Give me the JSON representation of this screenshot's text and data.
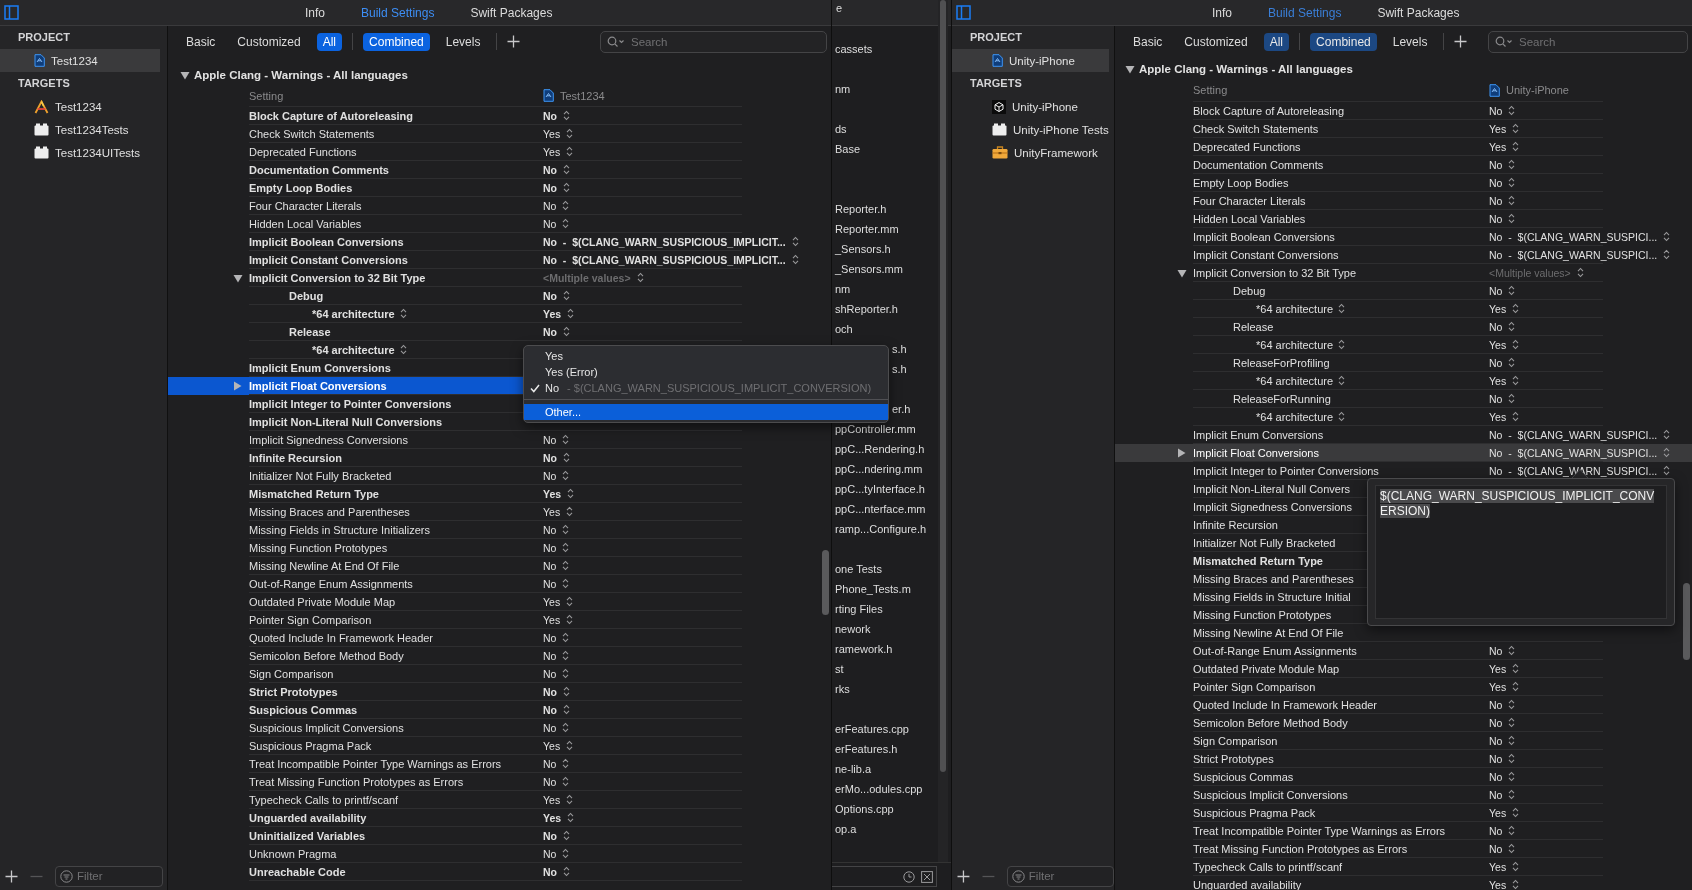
{
  "left_window": {
    "active": true,
    "tabs": [
      {
        "label": "Info",
        "selected": false
      },
      {
        "label": "Build Settings",
        "selected": true
      },
      {
        "label": "Swift Packages",
        "selected": false
      }
    ],
    "sidebar": {
      "sections": [
        {
          "title": "PROJECT",
          "items": [
            {
              "label": "Test1234",
              "kind": "project",
              "selected": true
            }
          ]
        },
        {
          "title": "TARGETS",
          "items": [
            {
              "label": "Test1234",
              "kind": "app",
              "selected": false
            },
            {
              "label": "Test1234Tests",
              "kind": "test_bundle",
              "selected": false
            },
            {
              "label": "Test1234UITests",
              "kind": "test_bundle",
              "selected": false
            }
          ]
        }
      ],
      "filter": {
        "placeholder": "Filter"
      }
    },
    "scope_buttons": [
      {
        "label": "Basic",
        "selected": false
      },
      {
        "label": "Customized",
        "selected": false
      },
      {
        "label": "All",
        "selected": true
      }
    ],
    "view_buttons": [
      {
        "label": "Combined",
        "selected": true
      },
      {
        "label": "Levels",
        "selected": false
      }
    ],
    "search": {
      "placeholder": "Search"
    },
    "section": {
      "title": "Apple Clang - Warnings - All languages",
      "expanded": true
    },
    "columns": {
      "setting": "Setting",
      "target": "Test1234"
    },
    "rows": [
      {
        "name": "Block Capture of Autoreleasing",
        "value": "No",
        "bold": true,
        "selected": false
      },
      {
        "name": "Check Switch Statements",
        "value": "Yes",
        "bold": false,
        "selected": false
      },
      {
        "name": "Deprecated Functions",
        "value": "Yes",
        "bold": false,
        "selected": false
      },
      {
        "name": "Documentation Comments",
        "value": "No",
        "bold": true,
        "selected": false
      },
      {
        "name": "Empty Loop Bodies",
        "value": "No",
        "bold": true,
        "selected": false
      },
      {
        "name": "Four Character Literals",
        "value": "No",
        "bold": false,
        "selected": false
      },
      {
        "name": "Hidden Local Variables",
        "value": "No",
        "bold": false,
        "selected": false
      },
      {
        "name": "Implicit Boolean Conversions",
        "value": "No  -  $(CLANG_WARN_SUSPICIOUS_IMPLICIT...",
        "bold": true,
        "selected": false
      },
      {
        "name": "Implicit Constant Conversions",
        "value": "No  -  $(CLANG_WARN_SUSPICIOUS_IMPLICIT...",
        "bold": true,
        "selected": false
      },
      {
        "name": "Implicit Conversion to 32 Bit Type",
        "value": "<Multiple values>",
        "mixed": true,
        "bold": true,
        "selected": false,
        "expanded": true,
        "children": [
          {
            "name": "Debug",
            "value": "No",
            "bold": true,
            "selected": false,
            "children": [
              {
                "name": "*64 architecture",
                "value": "Yes",
                "bold": true,
                "selected": false
              }
            ]
          },
          {
            "name": "Release",
            "value": "No",
            "bold": true,
            "selected": false,
            "children": [
              {
                "name": "*64 architecture",
                "bold": true,
                "selected": false
              }
            ]
          }
        ]
      },
      {
        "name": "Implicit Enum Conversions",
        "bold": true,
        "selected": false
      },
      {
        "name": "Implicit Float Conversions",
        "bold": true,
        "selected": true,
        "expanded": false
      },
      {
        "name": "Implicit Integer to Pointer Conversions",
        "bold": true,
        "selected": false
      },
      {
        "name": "Implicit Non-Literal Null Conversions",
        "bold": true,
        "selected": false
      },
      {
        "name": "Implicit Signedness Conversions",
        "value": "No",
        "bold": false,
        "selected": false
      },
      {
        "name": "Infinite Recursion",
        "value": "No",
        "bold": true,
        "selected": false
      },
      {
        "name": "Initializer Not Fully Bracketed",
        "value": "No",
        "bold": false,
        "selected": false
      },
      {
        "name": "Mismatched Return Type",
        "value": "Yes",
        "bold": true,
        "selected": false
      },
      {
        "name": "Missing Braces and Parentheses",
        "value": "Yes",
        "bold": false,
        "selected": false
      },
      {
        "name": "Missing Fields in Structure Initializers",
        "value": "No",
        "bold": false,
        "selected": false
      },
      {
        "name": "Missing Function Prototypes",
        "value": "No",
        "bold": false,
        "selected": false
      },
      {
        "name": "Missing Newline At End Of File",
        "value": "No",
        "bold": false,
        "selected": false
      },
      {
        "name": "Out-of-Range Enum Assignments",
        "value": "No",
        "bold": false,
        "selected": false
      },
      {
        "name": "Outdated Private Module Map",
        "value": "Yes",
        "bold": false,
        "selected": false
      },
      {
        "name": "Pointer Sign Comparison",
        "value": "Yes",
        "bold": false,
        "selected": false
      },
      {
        "name": "Quoted Include In Framework Header",
        "value": "No",
        "bold": false,
        "selected": false
      },
      {
        "name": "Semicolon Before Method Body",
        "value": "No",
        "bold": false,
        "selected": false
      },
      {
        "name": "Sign Comparison",
        "value": "No",
        "bold": false,
        "selected": false
      },
      {
        "name": "Strict Prototypes",
        "value": "No",
        "bold": true,
        "selected": false
      },
      {
        "name": "Suspicious Commas",
        "value": "No",
        "bold": true,
        "selected": false
      },
      {
        "name": "Suspicious Implicit Conversions",
        "value": "No",
        "bold": false,
        "selected": false
      },
      {
        "name": "Suspicious Pragma Pack",
        "value": "Yes",
        "bold": false,
        "selected": false
      },
      {
        "name": "Treat Incompatible Pointer Type Warnings as Errors",
        "value": "No",
        "bold": false,
        "selected": false
      },
      {
        "name": "Treat Missing Function Prototypes as Errors",
        "value": "No",
        "bold": false,
        "selected": false
      },
      {
        "name": "Typecheck Calls to printf/scanf",
        "value": "Yes",
        "bold": false,
        "selected": false
      },
      {
        "name": "Unguarded availability",
        "value": "Yes",
        "bold": true,
        "selected": false
      },
      {
        "name": "Uninitialized Variables",
        "value": "No",
        "bold": true,
        "selected": false
      },
      {
        "name": "Unknown Pragma",
        "value": "No",
        "bold": false,
        "selected": false
      },
      {
        "name": "Unreachable Code",
        "value": "No",
        "bold": true,
        "selected": false
      }
    ],
    "popup_menu": {
      "items": [
        {
          "kind": "option",
          "label": "Yes",
          "checked": false,
          "selected": false
        },
        {
          "kind": "option",
          "label": "Yes (Error)",
          "checked": false,
          "selected": false
        },
        {
          "kind": "option",
          "label": "No",
          "detail": "-  $(CLANG_WARN_SUSPICIOUS_IMPLICIT_CONVERSION)",
          "checked": true,
          "selected": false
        },
        {
          "kind": "action",
          "label": "Other...",
          "checked": false,
          "selected": true
        }
      ]
    }
  },
  "file_list": {
    "header": "e",
    "entries": [
      {
        "kind": "file",
        "name": "cassets"
      },
      {
        "kind": "blank"
      },
      {
        "kind": "file",
        "name": "nm"
      },
      {
        "kind": "blank"
      },
      {
        "kind": "file",
        "name": "ds"
      },
      {
        "kind": "file",
        "name": "Base"
      },
      {
        "kind": "blank"
      },
      {
        "kind": "blank"
      },
      {
        "kind": "file",
        "name": "Reporter.h"
      },
      {
        "kind": "file",
        "name": "Reporter.mm"
      },
      {
        "kind": "file",
        "name": "_Sensors.h"
      },
      {
        "kind": "file",
        "name": "_Sensors.mm"
      },
      {
        "kind": "file",
        "name": "nm"
      },
      {
        "kind": "file",
        "name": "shReporter.h"
      },
      {
        "kind": "file",
        "name": "och"
      },
      {
        "kind": "clipped",
        "name": "s.h"
      },
      {
        "kind": "clipped",
        "name": "s.h"
      },
      {
        "kind": "blank"
      },
      {
        "kind": "clipped",
        "name": "er.h"
      },
      {
        "kind": "file",
        "name": "ppController.mm"
      },
      {
        "kind": "file",
        "name": "ppC...Rendering.h"
      },
      {
        "kind": "file",
        "name": "ppC...ndering.mm"
      },
      {
        "kind": "file",
        "name": "ppC...tyInterface.h"
      },
      {
        "kind": "file",
        "name": "ppC...nterface.mm"
      },
      {
        "kind": "file",
        "name": "ramp...Configure.h"
      },
      {
        "kind": "blank"
      },
      {
        "kind": "file",
        "name": "one Tests"
      },
      {
        "kind": "file",
        "name": "Phone_Tests.m"
      },
      {
        "kind": "file",
        "name": "rting Files"
      },
      {
        "kind": "file",
        "name": "nework"
      },
      {
        "kind": "file",
        "name": "ramework.h"
      },
      {
        "kind": "file",
        "name": "st"
      },
      {
        "kind": "file",
        "name": "rks"
      },
      {
        "kind": "blank"
      },
      {
        "kind": "file",
        "name": "erFeatures.cpp"
      },
      {
        "kind": "file",
        "name": "erFeatures.h"
      },
      {
        "kind": "file",
        "name": "ne-lib.a"
      },
      {
        "kind": "file",
        "name": "erMo...odules.cpp"
      },
      {
        "kind": "file",
        "name": "Options.cpp"
      },
      {
        "kind": "file",
        "name": "op.a"
      }
    ]
  },
  "right_window": {
    "active": false,
    "tabs": [
      {
        "label": "Info",
        "selected": false
      },
      {
        "label": "Build Settings",
        "selected": true
      },
      {
        "label": "Swift Packages",
        "selected": false
      }
    ],
    "sidebar": {
      "sections": [
        {
          "title": "PROJECT",
          "items": [
            {
              "label": "Unity-iPhone",
              "kind": "project",
              "selected": true
            }
          ]
        },
        {
          "title": "TARGETS",
          "items": [
            {
              "label": "Unity-iPhone",
              "kind": "game_app",
              "selected": false
            },
            {
              "label": "Unity-iPhone Tests",
              "kind": "test_bundle",
              "selected": false
            },
            {
              "label": "UnityFramework",
              "kind": "framework",
              "selected": false
            }
          ]
        }
      ],
      "filter": {
        "placeholder": "Filter"
      }
    },
    "scope_buttons": [
      {
        "label": "Basic",
        "selected": false
      },
      {
        "label": "Customized",
        "selected": false
      },
      {
        "label": "All",
        "selected": true
      }
    ],
    "view_buttons": [
      {
        "label": "Combined",
        "selected": true
      },
      {
        "label": "Levels",
        "selected": false
      }
    ],
    "search": {
      "placeholder": "Search"
    },
    "section": {
      "title": "Apple Clang - Warnings - All languages",
      "expanded": true
    },
    "columns": {
      "setting": "Setting",
      "target": "Unity-iPhone"
    },
    "rows": [
      {
        "name": "Block Capture of Autoreleasing",
        "value": "No",
        "bold": false,
        "selected": false
      },
      {
        "name": "Check Switch Statements",
        "value": "Yes",
        "bold": false,
        "selected": false
      },
      {
        "name": "Deprecated Functions",
        "value": "Yes",
        "bold": false,
        "selected": false
      },
      {
        "name": "Documentation Comments",
        "value": "No",
        "bold": false,
        "selected": false
      },
      {
        "name": "Empty Loop Bodies",
        "value": "No",
        "bold": false,
        "selected": false
      },
      {
        "name": "Four Character Literals",
        "value": "No",
        "bold": false,
        "selected": false
      },
      {
        "name": "Hidden Local Variables",
        "value": "No",
        "bold": false,
        "selected": false
      },
      {
        "name": "Implicit Boolean Conversions",
        "value": "No  -  $(CLANG_WARN_SUSPICI...",
        "bold": false,
        "selected": false
      },
      {
        "name": "Implicit Constant Conversions",
        "value": "No  -  $(CLANG_WARN_SUSPICI...",
        "bold": false,
        "selected": false
      },
      {
        "name": "Implicit Conversion to 32 Bit Type",
        "value": "<Multiple values>",
        "mixed": true,
        "bold": false,
        "selected": false,
        "expanded": true,
        "children": [
          {
            "name": "Debug",
            "value": "No",
            "bold": false,
            "selected": false,
            "children": [
              {
                "name": "*64 architecture",
                "value": "Yes",
                "bold": false,
                "selected": false
              }
            ]
          },
          {
            "name": "Release",
            "value": "No",
            "bold": false,
            "selected": false,
            "children": [
              {
                "name": "*64 architecture",
                "value": "Yes",
                "bold": false,
                "selected": false
              }
            ]
          },
          {
            "name": "ReleaseForProfiling",
            "value": "No",
            "bold": false,
            "selected": false,
            "children": [
              {
                "name": "*64 architecture",
                "value": "Yes",
                "bold": false,
                "selected": false
              }
            ]
          },
          {
            "name": "ReleaseForRunning",
            "value": "No",
            "bold": false,
            "selected": false,
            "children": [
              {
                "name": "*64 architecture",
                "value": "Yes",
                "bold": false,
                "selected": false
              }
            ]
          }
        ]
      },
      {
        "name": "Implicit Enum Conversions",
        "value": "No  -  $(CLANG_WARN_SUSPICI...",
        "bold": false,
        "selected": false
      },
      {
        "name": "Implicit Float Conversions",
        "value": "No  -  $(CLANG_WARN_SUSPICI...",
        "bold": false,
        "selected": true,
        "expanded": false
      },
      {
        "name": "Implicit Integer to Pointer Conversions",
        "value": "No  -  $(CLANG_WARN_SUSPICI...",
        "bold": false,
        "selected": false
      },
      {
        "name": "Implicit Non-Literal Null Convers",
        "bold": false,
        "selected": false
      },
      {
        "name": "Implicit Signedness Conversions",
        "bold": false,
        "selected": false
      },
      {
        "name": "Infinite Recursion",
        "bold": false,
        "selected": false
      },
      {
        "name": "Initializer Not Fully Bracketed",
        "bold": false,
        "selected": false
      },
      {
        "name": "Mismatched Return Type",
        "bold": true,
        "selected": false
      },
      {
        "name": "Missing Braces and Parentheses",
        "bold": false,
        "selected": false
      },
      {
        "name": "Missing Fields in Structure Initial",
        "bold": false,
        "selected": false
      },
      {
        "name": "Missing Function Prototypes",
        "bold": false,
        "selected": false
      },
      {
        "name": "Missing Newline At End Of File",
        "bold": false,
        "selected": false
      },
      {
        "name": "Out-of-Range Enum Assignments",
        "value": "No",
        "bold": false,
        "selected": false
      },
      {
        "name": "Outdated Private Module Map",
        "value": "Yes",
        "bold": false,
        "selected": false
      },
      {
        "name": "Pointer Sign Comparison",
        "value": "Yes",
        "bold": false,
        "selected": false
      },
      {
        "name": "Quoted Include In Framework Header",
        "value": "No",
        "bold": false,
        "selected": false
      },
      {
        "name": "Semicolon Before Method Body",
        "value": "No",
        "bold": false,
        "selected": false
      },
      {
        "name": "Sign Comparison",
        "value": "No",
        "bold": false,
        "selected": false
      },
      {
        "name": "Strict Prototypes",
        "value": "No",
        "bold": false,
        "selected": false
      },
      {
        "name": "Suspicious Commas",
        "value": "No",
        "bold": false,
        "selected": false
      },
      {
        "name": "Suspicious Implicit Conversions",
        "value": "No",
        "bold": false,
        "selected": false
      },
      {
        "name": "Suspicious Pragma Pack",
        "value": "Yes",
        "bold": false,
        "selected": false
      },
      {
        "name": "Treat Incompatible Pointer Type Warnings as Errors",
        "value": "No",
        "bold": false,
        "selected": false
      },
      {
        "name": "Treat Missing Function Prototypes as Errors",
        "value": "No",
        "bold": false,
        "selected": false
      },
      {
        "name": "Typecheck Calls to printf/scanf",
        "value": "Yes",
        "bold": false,
        "selected": false
      },
      {
        "name": "Unguarded availability",
        "value": "Yes",
        "bold": false,
        "selected": false
      }
    ],
    "popover": {
      "value": "$(CLANG_WARN_SUSPICIOUS_IMPLICIT_CONVERSION)"
    }
  }
}
